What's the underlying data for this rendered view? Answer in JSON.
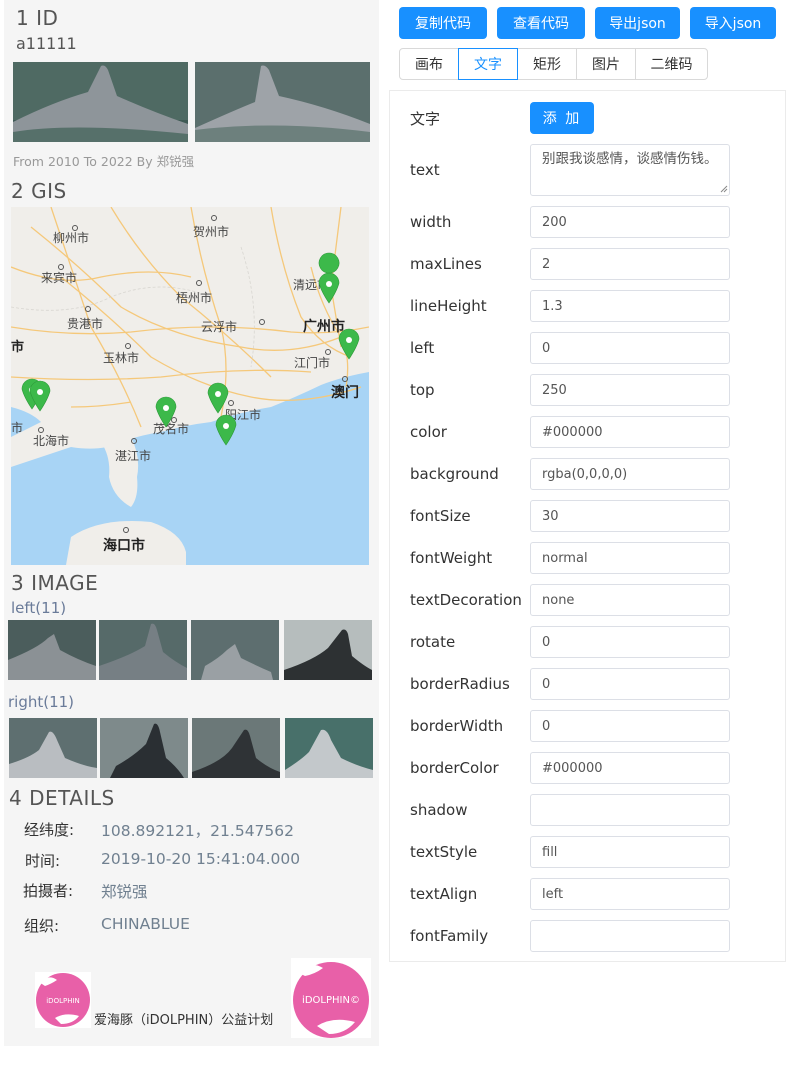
{
  "left": {
    "id_title": "1 ID",
    "id_value": "a11111",
    "id_caption": "From 2010 To 2022 By 郑锐强",
    "gis_title": "2 GIS",
    "image_title": "3 IMAGE",
    "left_label": "left(11)",
    "right_label": "right(11)",
    "details_title": "4 DETAILS",
    "details": [
      {
        "label": "经纬度:",
        "value": "108.892121，21.547562"
      },
      {
        "label": "时间:",
        "value": "2019-10-20 15:41:04.000"
      },
      {
        "label": "拍摄者:",
        "value": "郑锐强"
      },
      {
        "label": "组织:",
        "value": "CHINABLUE"
      }
    ],
    "footer_text": "爱海豚（iDOLPHIN）公益计划",
    "logo_text": "iDOLPHIN",
    "logo_text_large": "iDOLPHIN©"
  },
  "map": {
    "cities": [
      "柳州市",
      "贺州市",
      "来宾市",
      "梧州市",
      "清远市",
      "贵港市",
      "云浮市",
      "广州市",
      "市",
      "玉林市",
      "江门市",
      "澳门",
      "阳江市",
      "茂名市",
      "市",
      "北海市",
      "湛江市",
      "海口市"
    ],
    "colors": {
      "land": "#f0eeea",
      "sea": "#a8d4f5",
      "road": "#f5c87a",
      "marker": "#3cb94a"
    }
  },
  "toolbar": {
    "buttons": [
      "复制代码",
      "查看代码",
      "导出json",
      "导入json"
    ]
  },
  "tabs": [
    "画布",
    "文字",
    "矩形",
    "图片",
    "二维码"
  ],
  "active_tab": "文字",
  "form": {
    "header_label": "文字",
    "add_label": "添 加",
    "fields": [
      {
        "label": "text",
        "value": "别跟我谈感情，谈感情伤钱。",
        "type": "textarea"
      },
      {
        "label": "width",
        "value": "200"
      },
      {
        "label": "maxLines",
        "value": "2"
      },
      {
        "label": "lineHeight",
        "value": "1.3"
      },
      {
        "label": "left",
        "value": "0"
      },
      {
        "label": "top",
        "value": "250"
      },
      {
        "label": "color",
        "value": "#000000"
      },
      {
        "label": "background",
        "value": "rgba(0,0,0,0)"
      },
      {
        "label": "fontSize",
        "value": "30"
      },
      {
        "label": "fontWeight",
        "value": "normal"
      },
      {
        "label": "textDecoration",
        "value": "none"
      },
      {
        "label": "rotate",
        "value": "0"
      },
      {
        "label": "borderRadius",
        "value": "0"
      },
      {
        "label": "borderWidth",
        "value": "0"
      },
      {
        "label": "borderColor",
        "value": "#000000"
      },
      {
        "label": "shadow",
        "value": ""
      },
      {
        "label": "textStyle",
        "value": "fill"
      },
      {
        "label": "textAlign",
        "value": "left"
      },
      {
        "label": "fontFamily",
        "value": ""
      }
    ]
  },
  "colors": {
    "primary": "#1890ff",
    "panel_bg": "#f5f5f5",
    "detail_value": "#708090"
  }
}
